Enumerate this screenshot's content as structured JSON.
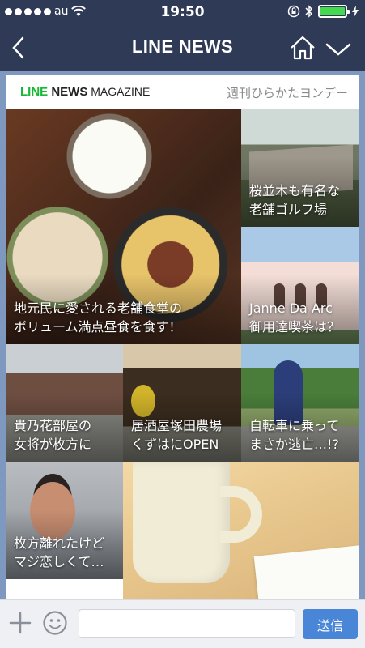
{
  "status_bar": {
    "carrier": "au",
    "time": "19:50",
    "battery_percent": 100,
    "battery_color": "#44d94e"
  },
  "nav": {
    "title": "LINE NEWS",
    "back_icon": "chevron-left-icon",
    "home_icon": "home-icon",
    "menu_icon": "chevron-down-icon",
    "bg_color": "#2f3a56"
  },
  "magazine": {
    "brand_line": "LINE",
    "brand_news": " NEWS",
    "brand_magazine": " MAGAZINE",
    "issue_title": "週刊ひらかたヨンデー",
    "brand_color": "#17b835",
    "articles": [
      {
        "caption": "地元民に愛される老舗食堂の\nボリューム満点昼食を食す！"
      },
      {
        "caption": "桜並木も有名な\n老舗ゴルフ場"
      },
      {
        "caption": "Janne Da Arc\n御用達喫茶は？"
      },
      {
        "caption": "貴乃花部屋の\n女将が枚方に"
      },
      {
        "caption": "居酒屋塚田農場\nくずはにOPEN"
      },
      {
        "caption": "自転車に乗って\nまさか逃亡…!?"
      },
      {
        "caption": "枚方離れたけど\nマジ恋しくて…"
      },
      {
        "caption": ""
      }
    ]
  },
  "composer": {
    "input_value": "",
    "send_label": "送信",
    "send_color": "#4a86d8"
  }
}
